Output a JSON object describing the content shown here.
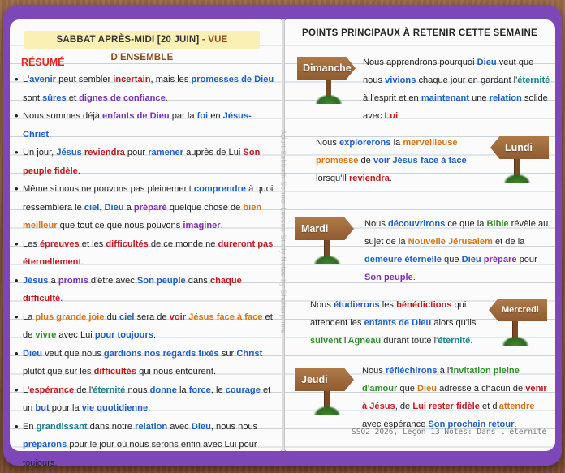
{
  "left_page": {
    "title_prefix": "SABBAT APRÈS-MIDI [20 JUIN]",
    "title_suffix": " - VUE D'ENSEMBLE",
    "section_heading": "RÉSUMÉ",
    "bullets": [
      [
        {
          "t": "L'"
        },
        {
          "t": "avenir",
          "c": "blue"
        },
        {
          "t": " peut sembler "
        },
        {
          "t": "incertain",
          "c": "red"
        },
        {
          "t": ", mais les "
        },
        {
          "t": "promesses de Dieu",
          "c": "blue"
        },
        {
          "t": " sont "
        },
        {
          "t": "sûres",
          "c": "blue"
        },
        {
          "t": " et "
        },
        {
          "t": "dignes de confiance",
          "c": "purple"
        },
        {
          "t": "."
        }
      ],
      [
        {
          "t": "Nous sommes déjà "
        },
        {
          "t": "enfants de Dieu",
          "c": "purple"
        },
        {
          "t": " par la "
        },
        {
          "t": "foi",
          "c": "blue"
        },
        {
          "t": " en "
        },
        {
          "t": "Jésus-Christ",
          "c": "blue"
        },
        {
          "t": "."
        }
      ],
      [
        {
          "t": "Un jour, "
        },
        {
          "t": "Jésus",
          "c": "blue"
        },
        {
          "t": " "
        },
        {
          "t": "reviendra",
          "c": "red"
        },
        {
          "t": " pour "
        },
        {
          "t": "ramener",
          "c": "blue"
        },
        {
          "t": " auprès de Lui "
        },
        {
          "t": "Son peuple",
          "c": "red"
        },
        {
          "t": " "
        },
        {
          "t": "fidèle",
          "c": "red"
        },
        {
          "t": "."
        }
      ],
      [
        {
          "t": "Même si nous ne pouvons pas pleinement "
        },
        {
          "t": "comprendre",
          "c": "blue"
        },
        {
          "t": " à quoi ressemblera le "
        },
        {
          "t": "ciel",
          "c": "blue"
        },
        {
          "t": ", "
        },
        {
          "t": "Dieu",
          "c": "blue"
        },
        {
          "t": " a "
        },
        {
          "t": "préparé",
          "c": "purple"
        },
        {
          "t": " quelque chose de "
        },
        {
          "t": "bien meilleur",
          "c": "orange"
        },
        {
          "t": " que tout ce que nous pouvons "
        },
        {
          "t": "imaginer",
          "c": "purple"
        },
        {
          "t": "."
        }
      ],
      [
        {
          "t": "Les "
        },
        {
          "t": "épreuves",
          "c": "red"
        },
        {
          "t": " et les "
        },
        {
          "t": "difficultés",
          "c": "red"
        },
        {
          "t": " de ce monde ne "
        },
        {
          "t": "dureront pas",
          "c": "red"
        },
        {
          "t": " "
        },
        {
          "t": "éternellement",
          "c": "red"
        },
        {
          "t": "."
        }
      ],
      [
        {
          "t": "Jésus",
          "c": "blue"
        },
        {
          "t": " a "
        },
        {
          "t": "promis",
          "c": "purple"
        },
        {
          "t": " d'être avec "
        },
        {
          "t": "Son peuple",
          "c": "blue"
        },
        {
          "t": " dans "
        },
        {
          "t": "chaque difficulté",
          "c": "red"
        },
        {
          "t": "."
        }
      ],
      [
        {
          "t": "La "
        },
        {
          "t": "plus grande joie",
          "c": "orange"
        },
        {
          "t": " du "
        },
        {
          "t": "ciel",
          "c": "blue"
        },
        {
          "t": " sera de "
        },
        {
          "t": "voir",
          "c": "red"
        },
        {
          "t": " "
        },
        {
          "t": "Jésus face à face",
          "c": "orange"
        },
        {
          "t": " et de "
        },
        {
          "t": "vivre",
          "c": "green"
        },
        {
          "t": " avec Lui "
        },
        {
          "t": "pour toujours",
          "c": "blue"
        },
        {
          "t": "."
        }
      ],
      [
        {
          "t": "Dieu",
          "c": "blue"
        },
        {
          "t": " veut que nous "
        },
        {
          "t": "gardions nos regards fixés",
          "c": "blue"
        },
        {
          "t": " sur "
        },
        {
          "t": "Christ",
          "c": "blue"
        },
        {
          "t": " plutôt que sur les "
        },
        {
          "t": "difficultés",
          "c": "red"
        },
        {
          "t": " qui nous entourent."
        }
      ],
      [
        {
          "t": "L'"
        },
        {
          "t": "espérance",
          "c": "red"
        },
        {
          "t": " de l'"
        },
        {
          "t": "éternité",
          "c": "teal"
        },
        {
          "t": " nous "
        },
        {
          "t": "donne",
          "c": "blue"
        },
        {
          "t": " la "
        },
        {
          "t": "force",
          "c": "blue"
        },
        {
          "t": ", le "
        },
        {
          "t": "courage",
          "c": "blue"
        },
        {
          "t": " et un "
        },
        {
          "t": "but",
          "c": "blue"
        },
        {
          "t": " pour la "
        },
        {
          "t": "vie quotidienne",
          "c": "blue"
        },
        {
          "t": "."
        }
      ],
      [
        {
          "t": "En "
        },
        {
          "t": "grandissant",
          "c": "teal"
        },
        {
          "t": " dans notre "
        },
        {
          "t": "relation",
          "c": "blue"
        },
        {
          "t": " avec "
        },
        {
          "t": "Dieu",
          "c": "blue"
        },
        {
          "t": ", nous nous "
        },
        {
          "t": "préparons",
          "c": "blue"
        },
        {
          "t": " pour le jour où nous serons enfin avec Lui pour toujours."
        }
      ]
    ]
  },
  "right_page": {
    "title": "POINTS PRINCIPAUX À RETENIR CETTE SEMAINE",
    "days": [
      {
        "sign": "Dimanche",
        "text": [
          {
            "t": "Nous apprendrons pourquoi "
          },
          {
            "t": "Dieu",
            "c": "blue"
          },
          {
            "t": " veut que nous "
          },
          {
            "t": "vivions",
            "c": "blue"
          },
          {
            "t": " chaque jour en gardant l'"
          },
          {
            "t": "éternité",
            "c": "teal"
          },
          {
            "t": " à l'esprit et en "
          },
          {
            "t": "maintenant",
            "c": "blue"
          },
          {
            "t": " une "
          },
          {
            "t": "relation",
            "c": "blue"
          },
          {
            "t": " solide avec "
          },
          {
            "t": "Lui",
            "c": "red"
          },
          {
            "t": "."
          }
        ]
      },
      {
        "sign": "Lundi",
        "text": [
          {
            "t": "Nous "
          },
          {
            "t": "explorerons",
            "c": "blue"
          },
          {
            "t": " la "
          },
          {
            "t": "merveilleuse",
            "c": "orange"
          },
          {
            "t": " "
          },
          {
            "t": "promesse",
            "c": "orange"
          },
          {
            "t": " de "
          },
          {
            "t": "voir",
            "c": "blue"
          },
          {
            "t": " "
          },
          {
            "t": "Jésus",
            "c": "blue"
          },
          {
            "t": " "
          },
          {
            "t": "face à face",
            "c": "blue"
          },
          {
            "t": " lorsqu'Il "
          },
          {
            "t": "reviendra",
            "c": "red"
          },
          {
            "t": "."
          }
        ]
      },
      {
        "sign": "Mardi",
        "text": [
          {
            "t": "Nous "
          },
          {
            "t": "découvrirons",
            "c": "blue"
          },
          {
            "t": " ce que la "
          },
          {
            "t": "Bible",
            "c": "green"
          },
          {
            "t": " révèle au sujet de la "
          },
          {
            "t": "Nouvelle Jérusalem",
            "c": "orange"
          },
          {
            "t": " et de la "
          },
          {
            "t": "demeure éternelle",
            "c": "blue"
          },
          {
            "t": " que "
          },
          {
            "t": "Dieu",
            "c": "blue"
          },
          {
            "t": " "
          },
          {
            "t": "prépare",
            "c": "purple"
          },
          {
            "t": " pour "
          },
          {
            "t": "Son peuple",
            "c": "purple"
          },
          {
            "t": "."
          }
        ]
      },
      {
        "sign": "Mercredi",
        "text": [
          {
            "t": "Nous "
          },
          {
            "t": "étudierons",
            "c": "blue"
          },
          {
            "t": " les "
          },
          {
            "t": "bénédictions",
            "c": "red"
          },
          {
            "t": " qui attendent les "
          },
          {
            "t": "enfants de Dieu",
            "c": "blue"
          },
          {
            "t": " alors qu'ils "
          },
          {
            "t": "suivent",
            "c": "green"
          },
          {
            "t": " l'"
          },
          {
            "t": "Agneau",
            "c": "green"
          },
          {
            "t": " durant toute l'"
          },
          {
            "t": "éternité",
            "c": "teal"
          },
          {
            "t": "."
          }
        ]
      },
      {
        "sign": "Jeudi",
        "text": [
          {
            "t": "Nous "
          },
          {
            "t": "réfléchirons",
            "c": "blue"
          },
          {
            "t": " à l'"
          },
          {
            "t": "invitation pleine d'amour",
            "c": "green"
          },
          {
            "t": " que "
          },
          {
            "t": "Dieu",
            "c": "orange"
          },
          {
            "t": " adresse à chacun de "
          },
          {
            "t": "venir",
            "c": "red"
          },
          {
            "t": " "
          },
          {
            "t": "à Jésus",
            "c": "red"
          },
          {
            "t": ", de "
          },
          {
            "t": "Lui rester fidèle",
            "c": "red"
          },
          {
            "t": " et d'"
          },
          {
            "t": "attendre",
            "c": "orange"
          },
          {
            "t": " avec espérance "
          },
          {
            "t": "Son prochain retour",
            "c": "blue"
          },
          {
            "t": "."
          }
        ]
      }
    ],
    "footer": "SSQ2 2026, Leçon 13 Notes: Dans l'éternité"
  },
  "watermark": "Adult Sabbath School Lesson Study Notes by Shelterprime",
  "colors": {
    "blue": "#1d5fc7",
    "red": "#c4171c",
    "green": "#2f8f2a",
    "orange": "#d97310",
    "purple": "#7e2fb0",
    "teal": "#177f8a",
    "cover": "#7d47b8",
    "banner": "#fbf0b4",
    "sign_wood": "#a06b3c"
  }
}
